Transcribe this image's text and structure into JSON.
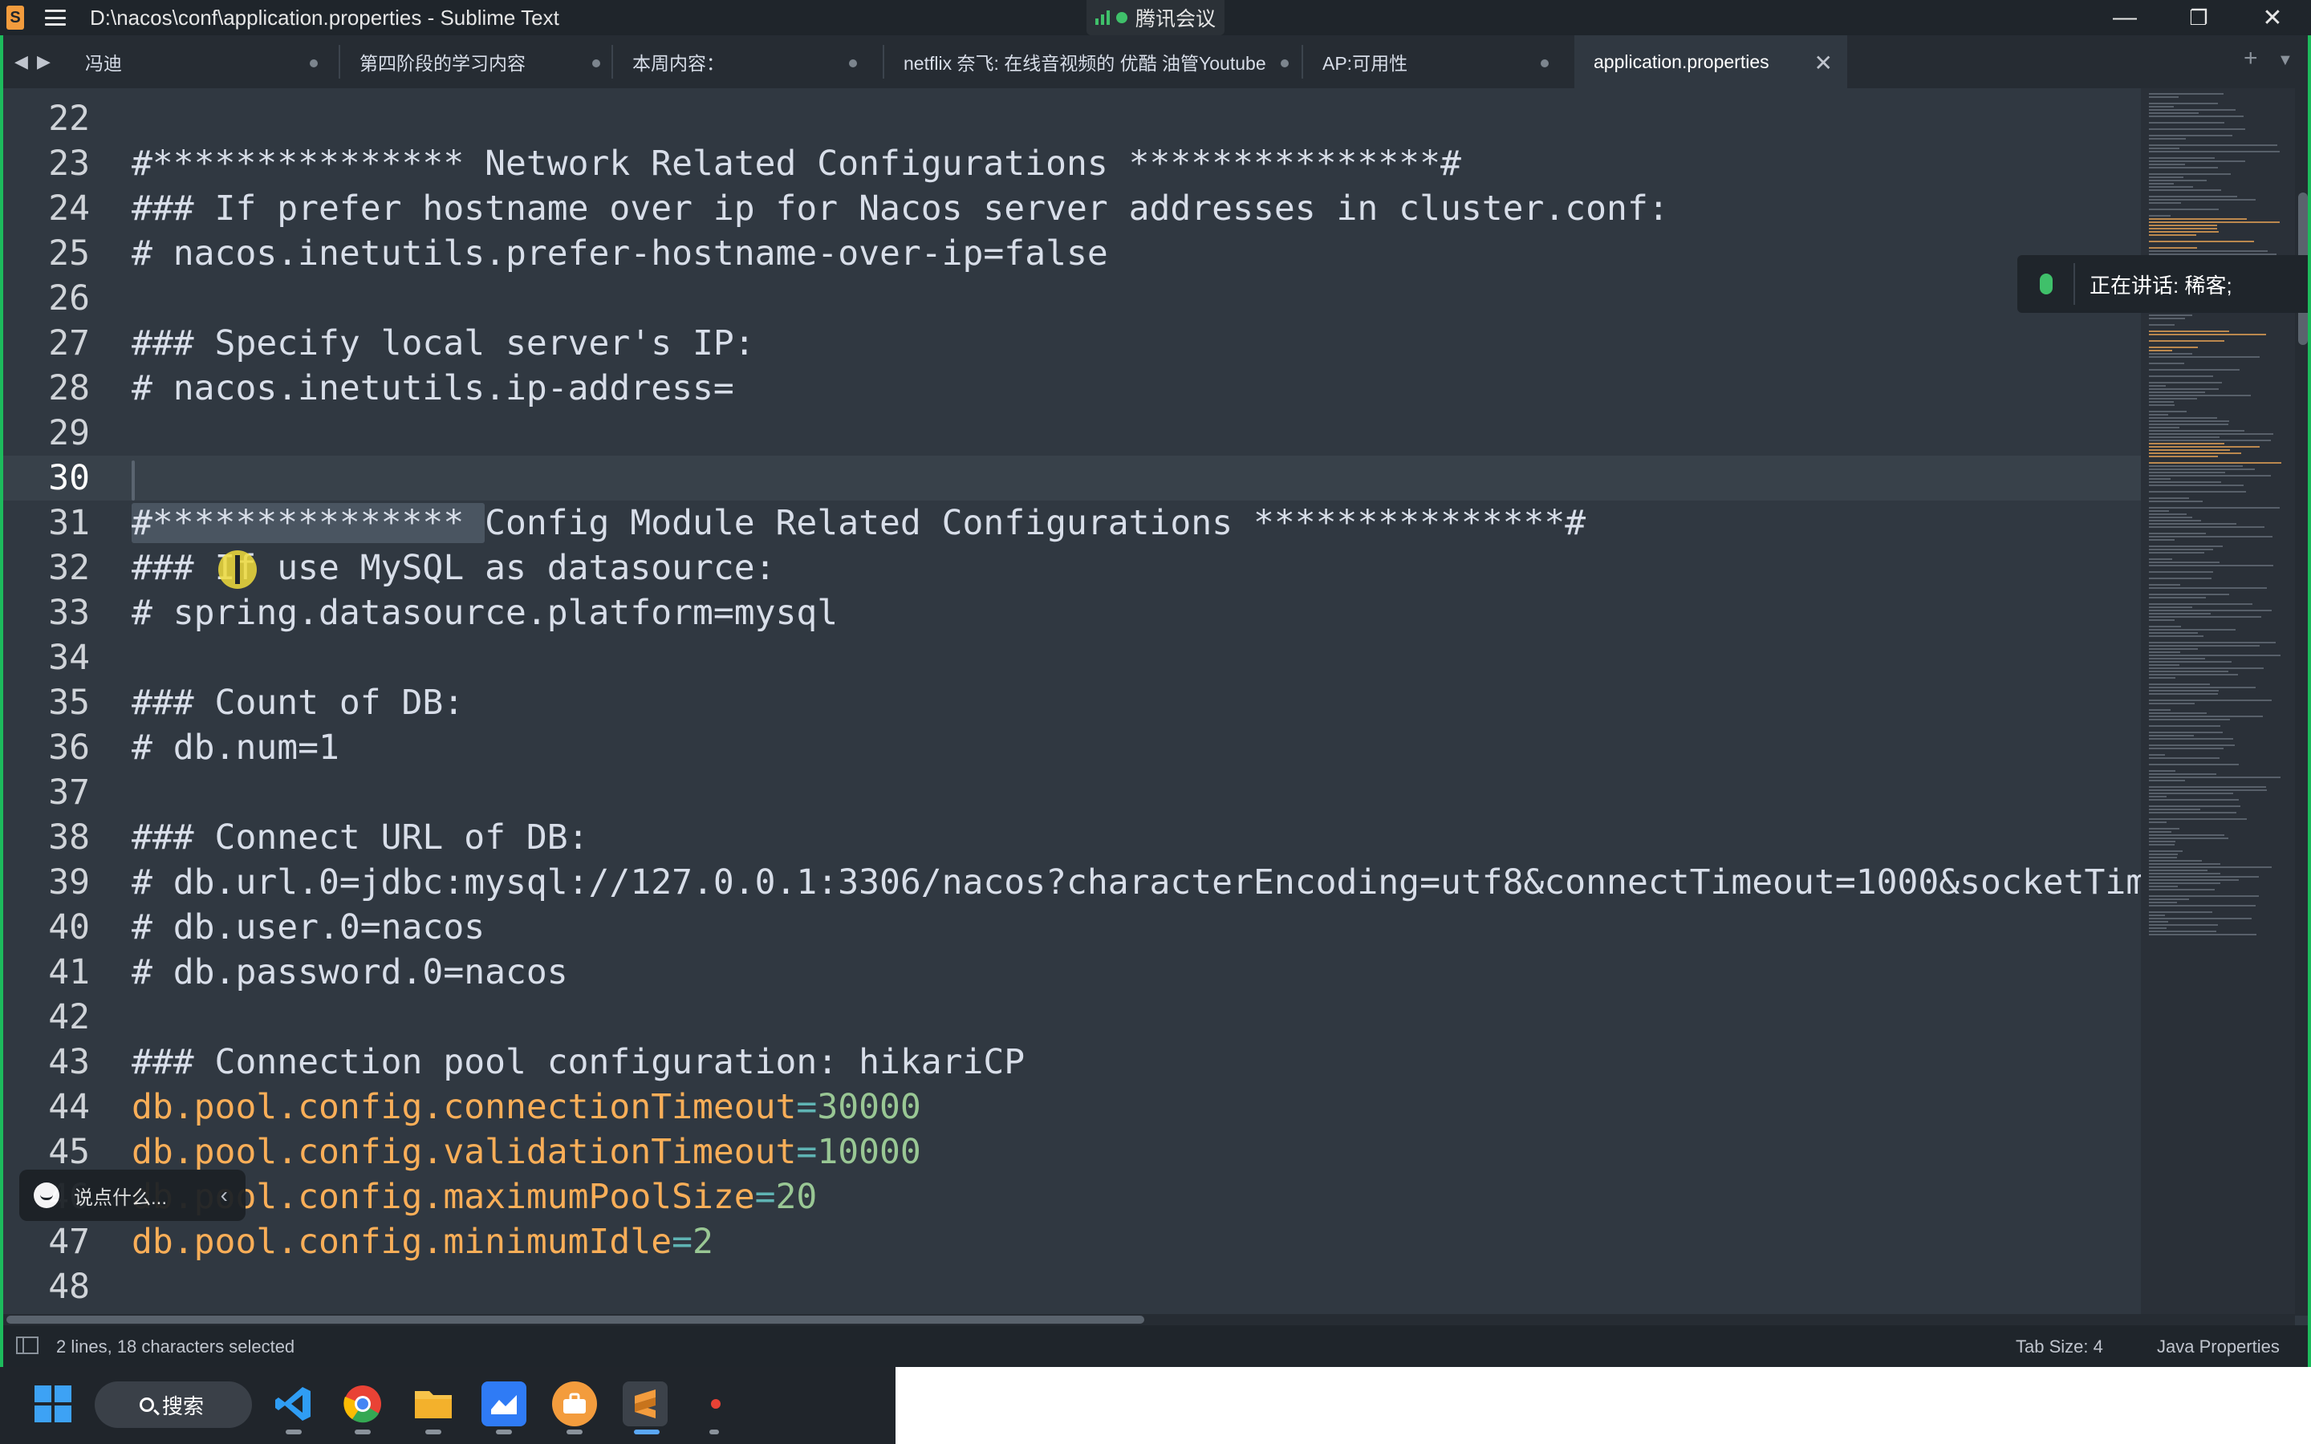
{
  "window": {
    "title": "D:\\nacos\\conf\\application.properties - Sublime Text",
    "app_icon_letter": "S",
    "minimize_glyph": "—",
    "maximize_glyph": "❐",
    "close_glyph": "✕"
  },
  "meeting": {
    "label": "腾讯会议"
  },
  "tabs": [
    {
      "label": "冯迪",
      "dirty": true
    },
    {
      "label": "第四阶段的学习内容",
      "dirty": true
    },
    {
      "label": "本周内容：",
      "dirty": true
    },
    {
      "label": "netflix 奈飞: 在线音视频的 优酷 油管Youtube",
      "dirty": true
    },
    {
      "label": "AP:可用性",
      "dirty": true
    },
    {
      "label": "application.properties",
      "active": true,
      "close_glyph": "✕"
    }
  ],
  "tab_tools": {
    "add": "+",
    "dropdown": "▼",
    "back": "◀",
    "forward": "▶"
  },
  "editor": {
    "lines": [
      {
        "n": "22",
        "text": ""
      },
      {
        "n": "23",
        "text": "#*************** Network Related Configurations ***************#"
      },
      {
        "n": "24",
        "text": "### If prefer hostname over ip for Nacos server addresses in cluster.conf:"
      },
      {
        "n": "25",
        "text": "# nacos.inetutils.prefer-hostname-over-ip=false"
      },
      {
        "n": "26",
        "text": ""
      },
      {
        "n": "27",
        "text": "### Specify local server's IP:"
      },
      {
        "n": "28",
        "text": "# nacos.inetutils.ip-address="
      },
      {
        "n": "29",
        "text": ""
      },
      {
        "n": "30",
        "text": ""
      },
      {
        "n": "31",
        "text_sel": "#*************** ",
        "text": "Config Module Related Configurations ***************#"
      },
      {
        "n": "32",
        "text": "### If use MySQL as datasource:"
      },
      {
        "n": "33",
        "text": "# spring.datasource.platform=mysql"
      },
      {
        "n": "34",
        "text": ""
      },
      {
        "n": "35",
        "text": "### Count of DB:"
      },
      {
        "n": "36",
        "text": "# db.num=1"
      },
      {
        "n": "37",
        "text": ""
      },
      {
        "n": "38",
        "text": "### Connect URL of DB:"
      },
      {
        "n": "39",
        "text": "# db.url.0=jdbc:mysql://127.0.0.1:3306/nacos?characterEncoding=utf8&connectTimeout=1000&socketTim"
      },
      {
        "n": "40",
        "text": "# db.user.0=nacos"
      },
      {
        "n": "41",
        "text": "# db.password.0=nacos"
      },
      {
        "n": "42",
        "text": ""
      },
      {
        "n": "43",
        "text": "### Connection pool configuration: hikariCP"
      },
      {
        "n": "44",
        "key": "db.pool.config.connectionTimeout",
        "eq": "=",
        "value": "30000"
      },
      {
        "n": "45",
        "key": "db.pool.config.validationTimeout",
        "eq": "=",
        "value": "10000"
      },
      {
        "n": "46",
        "key": "db.pool.config.maximumPoolSize",
        "eq": "=",
        "value": "20"
      },
      {
        "n": "47",
        "key": "db.pool.config.minimumIdle",
        "eq": "=",
        "value": "2"
      },
      {
        "n": "48",
        "text": ""
      }
    ]
  },
  "speaking": {
    "label": "正在讲话: 稀客;"
  },
  "chat": {
    "placeholder": "说点什么...",
    "chevron": "‹"
  },
  "status": {
    "selection": "2 lines, 18 characters selected",
    "tab_size": "Tab Size: 4",
    "syntax": "Java Properties"
  },
  "taskbar": {
    "search_label": "搜索",
    "apps": [
      "windows-start",
      "vscode",
      "chrome",
      "file-explorer",
      "lark",
      "briefcase",
      "sublime-text",
      "recorder"
    ]
  },
  "colors": {
    "background": "#303841",
    "comment": "#d8dee9",
    "key": "#f9ae58",
    "number": "#99c794",
    "operator": "#5fb4b4",
    "accent_green": "#1dbb5c"
  }
}
